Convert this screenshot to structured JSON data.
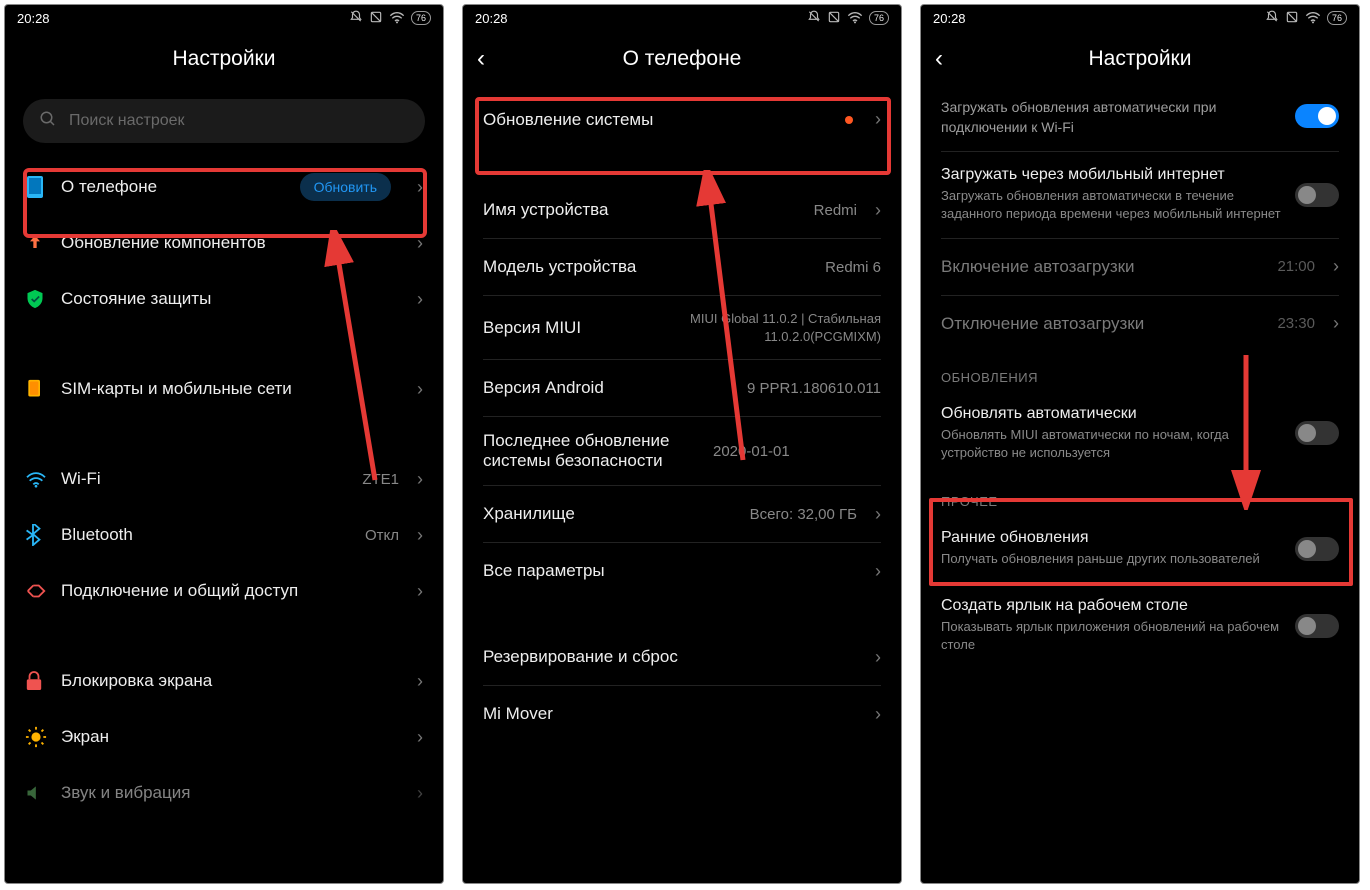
{
  "status": {
    "time": "20:28",
    "battery": "76"
  },
  "screen1": {
    "title": "Настройки",
    "search_placeholder": "Поиск настроек",
    "about_label": "О телефоне",
    "update_badge": "Обновить",
    "components_label": "Обновление компонентов",
    "security_label": "Состояние защиты",
    "sim_label": "SIM-карты и мобильные сети",
    "wifi_label": "Wi-Fi",
    "wifi_value": "ZTE1",
    "bt_label": "Bluetooth",
    "bt_value": "Откл",
    "share_label": "Подключение и общий доступ",
    "lock_label": "Блокировка экрана",
    "display_label": "Экран",
    "sound_label": "Звук и вибрация"
  },
  "screen2": {
    "title": "О телефоне",
    "sysupdate_label": "Обновление системы",
    "devname_label": "Имя устройства",
    "devname_value": "Redmi",
    "model_label": "Модель устройства",
    "model_value": "Redmi 6",
    "miui_label": "Версия MIUI",
    "miui_value": "MIUI Global 11.0.2 | Стабильная 11.0.2.0(PCGMIXM)",
    "android_label": "Версия Android",
    "android_value": "9 PPR1.180610.011",
    "secpatch_label": "Последнее обновление системы безопасности",
    "secpatch_value": "2020-01-01",
    "storage_label": "Хранилище",
    "storage_value": "Всего: 32,00 ГБ",
    "allspecs_label": "Все параметры",
    "backup_label": "Резервирование и сброс",
    "mimover_label": "Mi Mover"
  },
  "screen3": {
    "title": "Настройки",
    "wifi_auto_label": "Загружать обновления автоматически при подключении к Wi-Fi",
    "mobile_label": "Загружать через мобильный интернет",
    "mobile_sub": "Загружать обновления автоматически в течение заданного периода времени через мобильный интернет",
    "auto_on_label": "Включение автозагрузки",
    "auto_on_value": "21:00",
    "auto_off_label": "Отключение автозагрузки",
    "auto_off_value": "23:30",
    "section_updates": "ОБНОВЛЕНИЯ",
    "auto_update_label": "Обновлять автоматически",
    "auto_update_sub": "Обновлять MIUI автоматически по ночам, когда устройство не используется",
    "section_other": "ПРОЧЕЕ",
    "early_label": "Ранние обновления",
    "early_sub": "Получать обновления раньше других пользователей",
    "shortcut_label": "Создать ярлык на рабочем столе",
    "shortcut_sub": "Показывать ярлык приложения обновлений на рабочем столе"
  }
}
